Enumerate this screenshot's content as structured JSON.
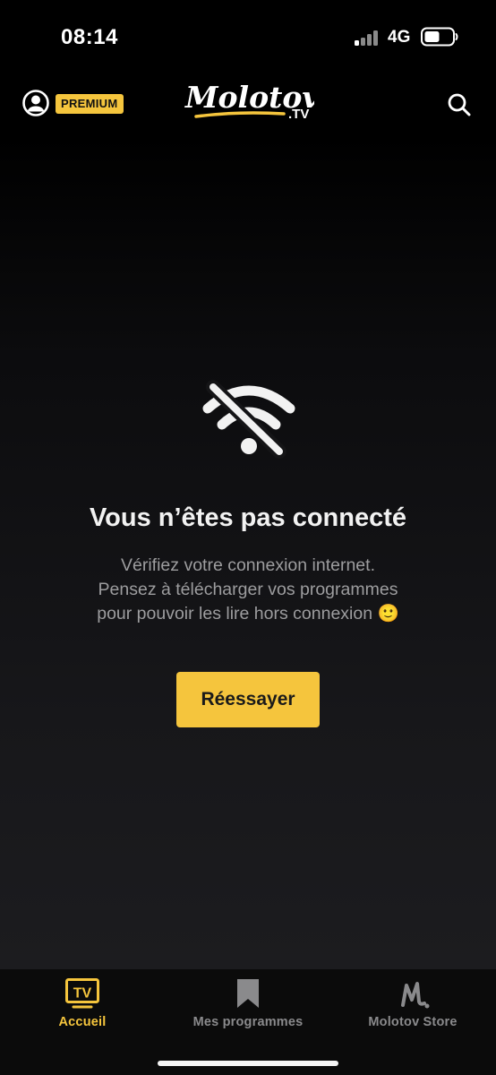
{
  "status_bar": {
    "time": "08:14",
    "network": "4G",
    "icons": [
      "cellular-signal-icon",
      "battery-icon"
    ]
  },
  "header": {
    "badge": "PREMIUM",
    "logo_text": "Molotov",
    "logo_suffix": ".TV",
    "icons": [
      "user-icon",
      "search-icon"
    ]
  },
  "offline": {
    "icon": "wifi-off-icon",
    "title": "Vous n’êtes pas connecté",
    "description_lines": [
      "Vérifiez votre connexion internet.",
      "Pensez à télécharger vos programmes",
      "pour pouvoir les lire hors connexion 🙂"
    ],
    "retry_label": "Réessayer"
  },
  "tabs": [
    {
      "label": "Accueil",
      "icon": "tv-icon",
      "active": true
    },
    {
      "label": "Mes programmes",
      "icon": "bookmark-icon",
      "active": false
    },
    {
      "label": "Molotov Store",
      "icon": "molotov-m-icon",
      "active": false
    }
  ],
  "colors": {
    "accent": "#f5c53d",
    "background": "#000000",
    "text_secondary": "#9d9d9f",
    "tab_inactive": "#8a8a8c"
  }
}
